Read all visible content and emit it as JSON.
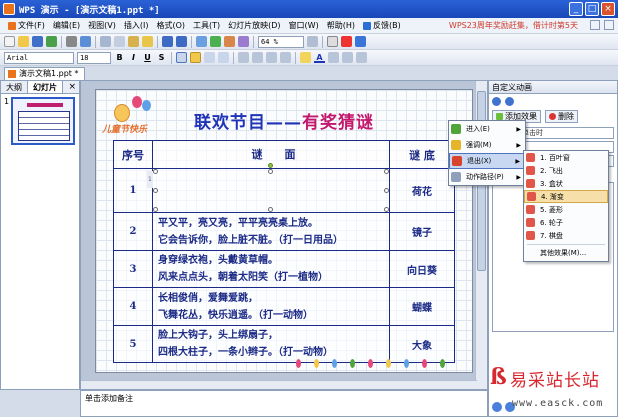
{
  "window": {
    "title": "WPS 演示 - [演示文稿1.ppt *]",
    "minimize": "_",
    "maximize": "□",
    "close": "×"
  },
  "menubar": {
    "items": [
      "文件(F)",
      "编辑(E)",
      "视图(V)",
      "插入(I)",
      "格式(O)",
      "工具(T)",
      "幻灯片放映(D)",
      "窗口(W)",
      "帮助(H)",
      "反馈(B)"
    ],
    "promo": "WPS23周年奖励赶集，借计时第5天"
  },
  "toolbar": {
    "zoom": "64 %",
    "font_name": "Arial",
    "font_size": "18",
    "bold": "B",
    "italic": "I",
    "underline": "U",
    "shadow": "S",
    "font_color_letter": "A"
  },
  "doc_tab": {
    "label": "演示文稿1.ppt *"
  },
  "left_pane": {
    "tabs": [
      "大纲",
      "幻灯片"
    ],
    "close": "×",
    "thumb_number": "1"
  },
  "slide": {
    "logo_text": "儿童节快乐",
    "title_part_a": "联欢节目——",
    "title_part_b": "有奖猜谜",
    "headers": [
      "序号",
      "谜　　面",
      "谜 底"
    ],
    "rows": [
      {
        "num": "1",
        "riddle_line1": "",
        "riddle_line2": "",
        "answer": "荷花",
        "marker": "1"
      },
      {
        "num": "2",
        "riddle_line1": "平又平，亮又亮，平平亮亮桌上放。",
        "riddle_line2": "它会告诉你，脸上脏不脏。（打一日用品）",
        "answer": "镜子"
      },
      {
        "num": "3",
        "riddle_line1": "身穿绿衣袍，头戴黄草帽。",
        "riddle_line2": "风来点点头，朝着太阳笑（打一植物）",
        "answer": "向日葵"
      },
      {
        "num": "4",
        "riddle_line1": "长相俊俏，爱舞爱跳，",
        "riddle_line2": "飞舞花丛，快乐逍遥。（打一动物）",
        "answer": "蝴蝶"
      },
      {
        "num": "5",
        "riddle_line1": "脸上大钩子，头上绑扇子，",
        "riddle_line2": "四根大柱子，一条小辫子。（打一动物）",
        "answer": "大象"
      }
    ]
  },
  "notes": {
    "placeholder": "单击添加备注"
  },
  "right_pane": {
    "title": "自定义动画",
    "add_effect": "添加效果",
    "delete": "删除",
    "start_value": "单击时",
    "list_item": "1"
  },
  "context_menu": {
    "items": [
      {
        "label": "进入(E)",
        "color": "#4fa53a"
      },
      {
        "label": "强调(M)",
        "color": "#e6b428"
      },
      {
        "label": "退出(X)",
        "color": "#d9452c"
      },
      {
        "label": "动作路径(P)",
        "color": "#8fa0bb"
      }
    ],
    "active_index": 2
  },
  "sub_menu": {
    "items": [
      "1. 百叶窗",
      "2. 飞出",
      "3. 盒状",
      "4. 渐变",
      "5. 菱形",
      "6. 轮子",
      "7. 棋盘"
    ],
    "active_index": 3,
    "more": "其他效果(M)..."
  },
  "watermark": {
    "logo": "ß",
    "text": "易采站长站",
    "url": "www.easck.com"
  },
  "colors": {
    "title_blue": "#1f33b7",
    "title_pink": "#c3186c",
    "table_blue": "#1b2a86",
    "titlebar": "#2a62d6"
  }
}
